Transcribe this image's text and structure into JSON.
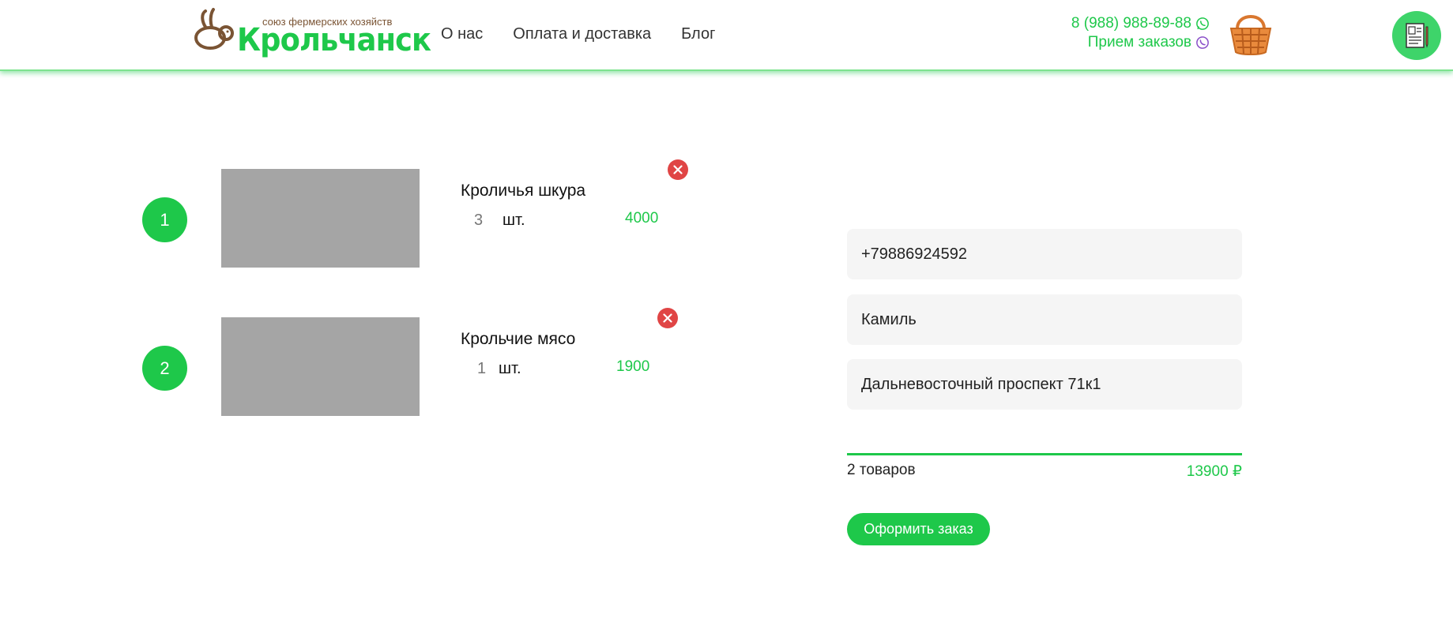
{
  "header": {
    "logo": {
      "tagline": "союз фермерских хозяйств",
      "name": "Крольчанск",
      "icon": "rabbit-logo-icon"
    },
    "nav": [
      "О нас",
      "Оплата и доставка",
      "Блог"
    ],
    "contact": {
      "phone": "8 (988) 988-89-88",
      "orders_label": "Прием заказов",
      "phone_icon": "whatsapp-icon",
      "orders_icon": "viber-icon"
    },
    "basket_icon": "basket-icon",
    "document_icon": "document-icon"
  },
  "cart": {
    "items": [
      {
        "index": "1",
        "name": "Кроличья шкура",
        "qty": "3",
        "unit": "шт.",
        "price": "4000"
      },
      {
        "index": "2",
        "name": "Крольчие мясо",
        "qty": "1",
        "unit": "шт.",
        "price": "1900"
      }
    ],
    "remove_icon": "close-icon"
  },
  "form": {
    "phone_value": "+79886924592",
    "name_value": "Камиль",
    "address_value": "Дальневосточный проспект 71к1"
  },
  "summary": {
    "count_label": "2 товаров",
    "total": "13900 ₽",
    "submit_label": "Оформить заказ"
  },
  "colors": {
    "accent": "#1ec84a",
    "remove": "#e04545",
    "placeholder": "#a5a5a5",
    "field_bg": "#f5f5f5"
  }
}
